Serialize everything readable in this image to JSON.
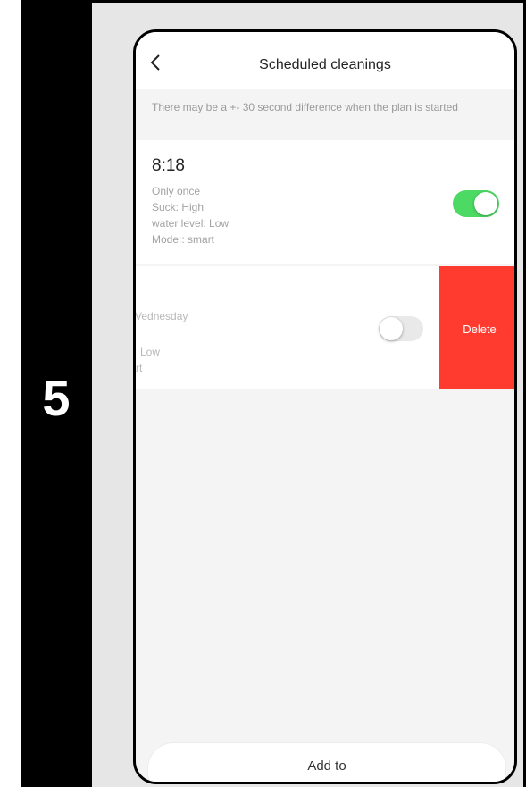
{
  "step": {
    "number": "5"
  },
  "header": {
    "title": "Scheduled cleanings",
    "back_icon": "chevron-left-icon"
  },
  "notice": {
    "text": "There may be a +- 30 second difference when the plan is started"
  },
  "schedules": [
    {
      "time": "8:18",
      "repeat": "Only once",
      "suction": "Suck: High",
      "water": "water level: Low",
      "mode": "Mode:: smart",
      "enabled": true
    },
    {
      "repeat_partial": "Vednesday",
      "water_partial": "Low",
      "mode_partial": "rt",
      "enabled": false,
      "delete_label": "Delete"
    }
  ],
  "footer": {
    "add_label": "Add to"
  },
  "colors": {
    "toggle_on": "#4cd964",
    "delete": "#ff3b30",
    "background": "#f4f4f4"
  }
}
